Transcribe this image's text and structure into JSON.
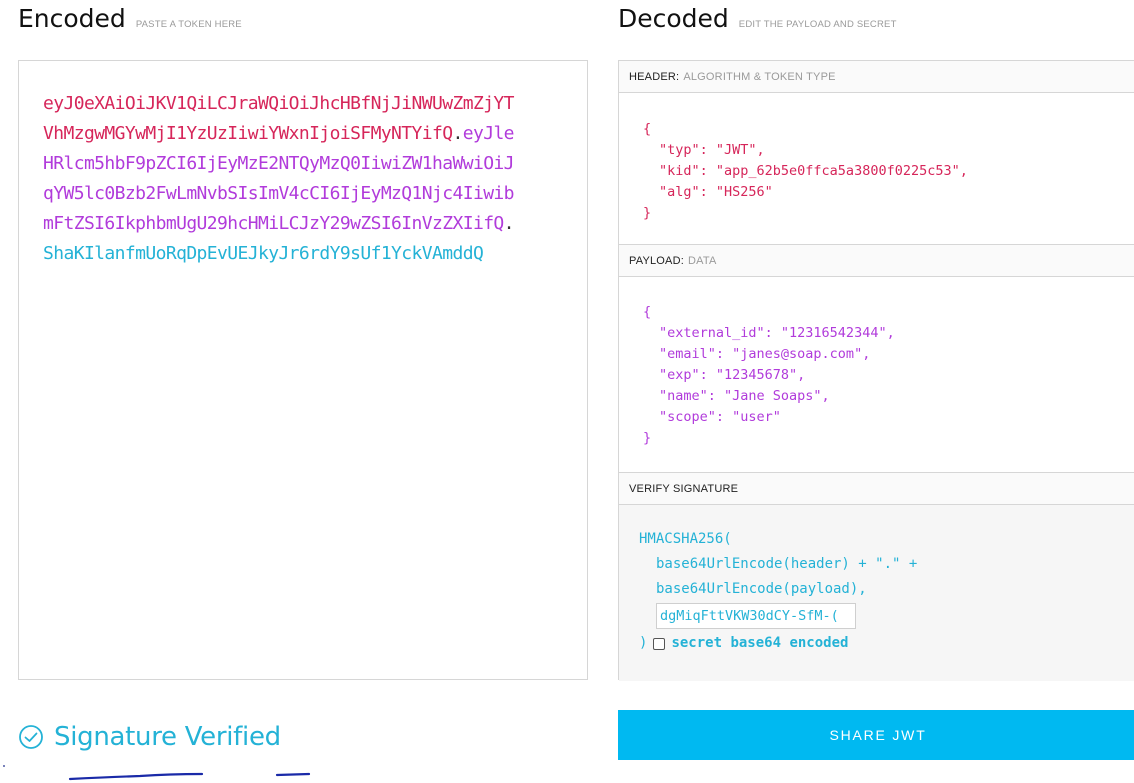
{
  "encoded": {
    "title": "Encoded",
    "caption": "PASTE A TOKEN HERE",
    "token_header": "eyJ0eXAiOiJKV1QiLCJraWQiOiJhcHBfNjJiNWUwZmZjYTVhMzgwMGYwMjI1YzUzIiwiYWxnIjoiSFMyNTYifQ",
    "dot1": ".",
    "token_payload": "eyJleHRlcm5hbF9pZCI6IjEyMzE2NTQyMzQ0IiwiZW1haWwiOiJqYW5lc0Bzb2FwLmNvbSIsImV4cCI6IjEyMzQ1Njc4IiwibmFtZSI6IkphbmUgU29hcHMiLCJzY29wZSI6InVzZXIifQ",
    "dot2": ".",
    "token_signature": "ShaKIlanfmUoRqDpEvUEJkyJr6rdY9sUf1YckVAmddQ"
  },
  "decoded": {
    "title": "Decoded",
    "caption": "EDIT THE PAYLOAD AND SECRET",
    "header_section": {
      "label": "HEADER:",
      "hint": "ALGORITHM & TOKEN TYPE",
      "open": "{",
      "lines": [
        "\"typ\": \"JWT\",",
        "\"kid\": \"app_62b5e0ffca5a3800f0225c53\",",
        "\"alg\": \"HS256\""
      ],
      "close": "}"
    },
    "payload_section": {
      "label": "PAYLOAD:",
      "hint": "DATA",
      "open": "{",
      "lines": [
        "\"external_id\": \"12316542344\",",
        "\"email\": \"janes@soap.com\",",
        "\"exp\": \"12345678\",",
        "\"name\": \"Jane Soaps\",",
        "\"scope\": \"user\""
      ],
      "close": "}"
    },
    "verify_section": {
      "label": "VERIFY SIGNATURE",
      "fn": "HMACSHA256(",
      "line1": "base64UrlEncode(header) + \".\" +",
      "line2": "base64UrlEncode(payload),",
      "secret_value": "dgMiqFttVKW30dCY-SfM-(",
      "close": ")",
      "checkbox_label": "secret base64 encoded",
      "checkbox_checked": false
    }
  },
  "status": {
    "verified_text": "Signature Verified",
    "verified_icon": "check-circle-icon"
  },
  "share_button": {
    "label": "SHARE JWT"
  },
  "colors": {
    "header": "#d6265a",
    "payload": "#b13bdb",
    "signature": "#24b2d6",
    "share_button": "#00b9f1"
  }
}
